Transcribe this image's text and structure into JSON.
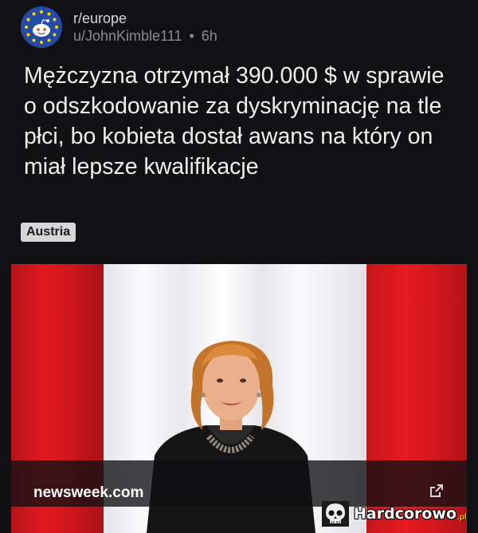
{
  "post": {
    "subreddit": "r/europe",
    "author": "u/JohnKimble111",
    "separator": "•",
    "age": "6h",
    "title": "Mężczyzna otrzymał 390.000 $ w sprawie o odszkodowanie za dyskryminację na tle płci, bo kobieta dostał awans na który on miał lepsze kwalifikacje",
    "flair": "Austria"
  },
  "media": {
    "link_domain": "newsweek.com",
    "open_icon": "external-link-icon"
  },
  "watermark": {
    "text": "Hardcorowo",
    "suffix": ".pl",
    "icon": "skull-icon"
  },
  "colors": {
    "background": "#111113",
    "flag_red": "#e1191f",
    "flag_white": "#fbfbfd",
    "flair_bg": "#d6d6d8",
    "watermark_accent": "#f2c200"
  }
}
